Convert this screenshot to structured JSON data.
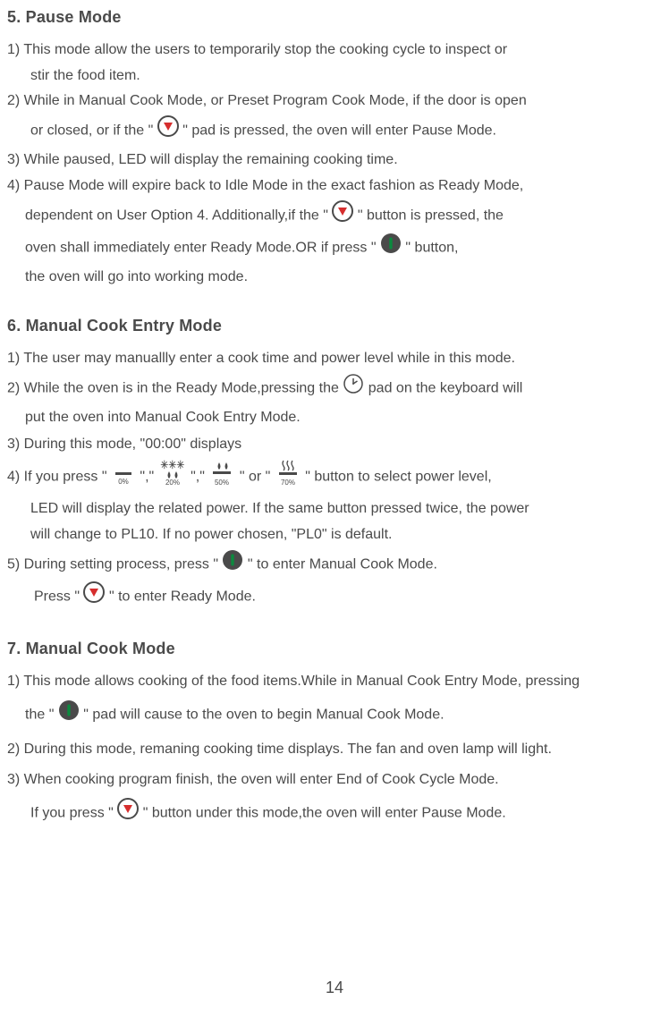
{
  "page_number": "14",
  "section5": {
    "title": "5. Pause Mode",
    "p1a": "1) This mode allow the users to temporarily stop the cooking cycle to inspect or",
    "p1b": "stir the food item.",
    "p2a": "2) While in Manual Cook Mode, or Preset Program Cook Mode, if the door is open",
    "p2b_pre": "or closed, or if the \"",
    "p2b_post": "\" pad is pressed, the oven will enter Pause Mode.",
    "p3": "3) While paused, LED will display the remaining cooking time.",
    "p4a": "4) Pause Mode will expire back to Idle Mode in the exact fashion as Ready Mode,",
    "p4b_pre": "dependent on User Option 4. Additionally,if the \"",
    "p4b_post": "\" button is pressed, the",
    "p4c_pre": "oven shall immediately enter Ready Mode.OR if press \"",
    "p4c_post": "\" button,",
    "p4d": "the oven will go into working mode."
  },
  "section6": {
    "title": "6. Manual Cook Entry Mode",
    "p1": "1) The user may manuallly enter a cook time and power level while in this mode.",
    "p2a_pre": "2) While the oven is in the Ready Mode,pressing the",
    "p2a_post": "pad on the keyboard will",
    "p2b": "put the oven into Manual Cook Entry Mode.",
    "p3": "3) During this mode, \"00:00\" displays",
    "p4a_pre": "4) If you press \"",
    "p4a_sep1": "\",\"",
    "p4a_sep2": "\",\"",
    "p4a_sep3": "\" or \"",
    "p4a_post": "\" button to select power level,",
    "p4b": "LED will display the related power. If the same button pressed twice, the power",
    "p4c": "will change to PL10. If no power chosen, \"PL0\" is default.",
    "p5a_pre": "5)  During setting process, press \"",
    "p5a_post": "\" to enter Manual Cook Mode.",
    "p5b_pre": "Press \"",
    "p5b_post": "\" to enter Ready Mode."
  },
  "section7": {
    "title": "7. Manual Cook Mode",
    "p1a": "1) This mode allows cooking of the food items.While in Manual Cook Entry Mode, pressing",
    "p1b_pre": "the \"",
    "p1b_post": "\" pad will cause to the oven to begin Manual Cook Mode.",
    "p2": "2) During this mode, remaning cooking time displays. The fan and oven lamp will light.",
    "p3a": "3) When cooking program finish, the oven will enter End of Cook Cycle Mode.",
    "p3b_pre": "If you press \"",
    "p3b_post": "\" button under this mode,the oven will enter Pause Mode."
  },
  "icons": {
    "pct0": "0%",
    "pct20": "20%",
    "pct50": "50%",
    "pct70": "70%"
  }
}
